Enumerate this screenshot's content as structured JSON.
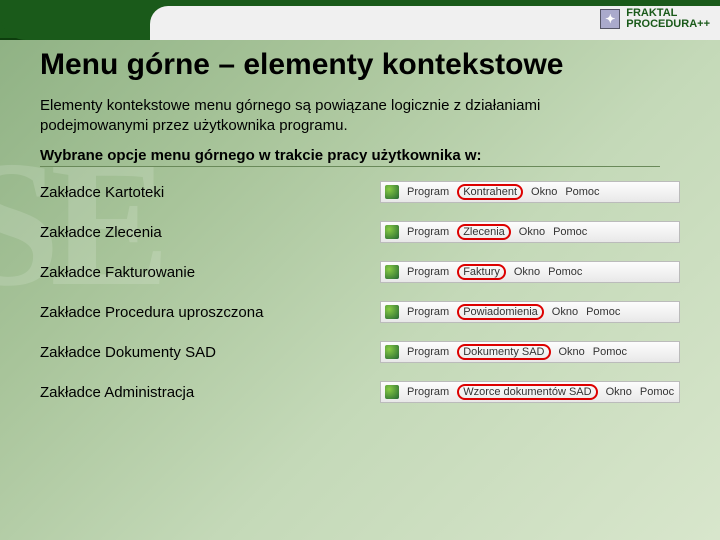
{
  "brand": {
    "line1": "FRAKTAL",
    "line2": "PROCEDURA++"
  },
  "title": "Menu górne – elementy kontekstowe",
  "intro": "Elementy kontekstowe menu górnego są powiązane logicznie z działaniami podejmowanymi przez użytkownika programu.",
  "subhead": "Wybrane opcje menu górnego w trakcie pracy użytkownika w:",
  "menu_common": {
    "program": "Program",
    "okno": "Okno",
    "pomoc": "Pomoc"
  },
  "rows": [
    {
      "label": "Zakładce Kartoteki",
      "context": "Kontrahent"
    },
    {
      "label": "Zakładce Zlecenia",
      "context": "Zlecenia"
    },
    {
      "label": "Zakładce Fakturowanie",
      "context": "Faktury"
    },
    {
      "label": "Zakładce Procedura uproszczona",
      "context": "Powiadomienia"
    },
    {
      "label": "Zakładce Dokumenty SAD",
      "context": "Dokumenty SAD"
    },
    {
      "label": "Zakładce Administracja",
      "context": "Wzorce dokumentów SAD"
    }
  ]
}
